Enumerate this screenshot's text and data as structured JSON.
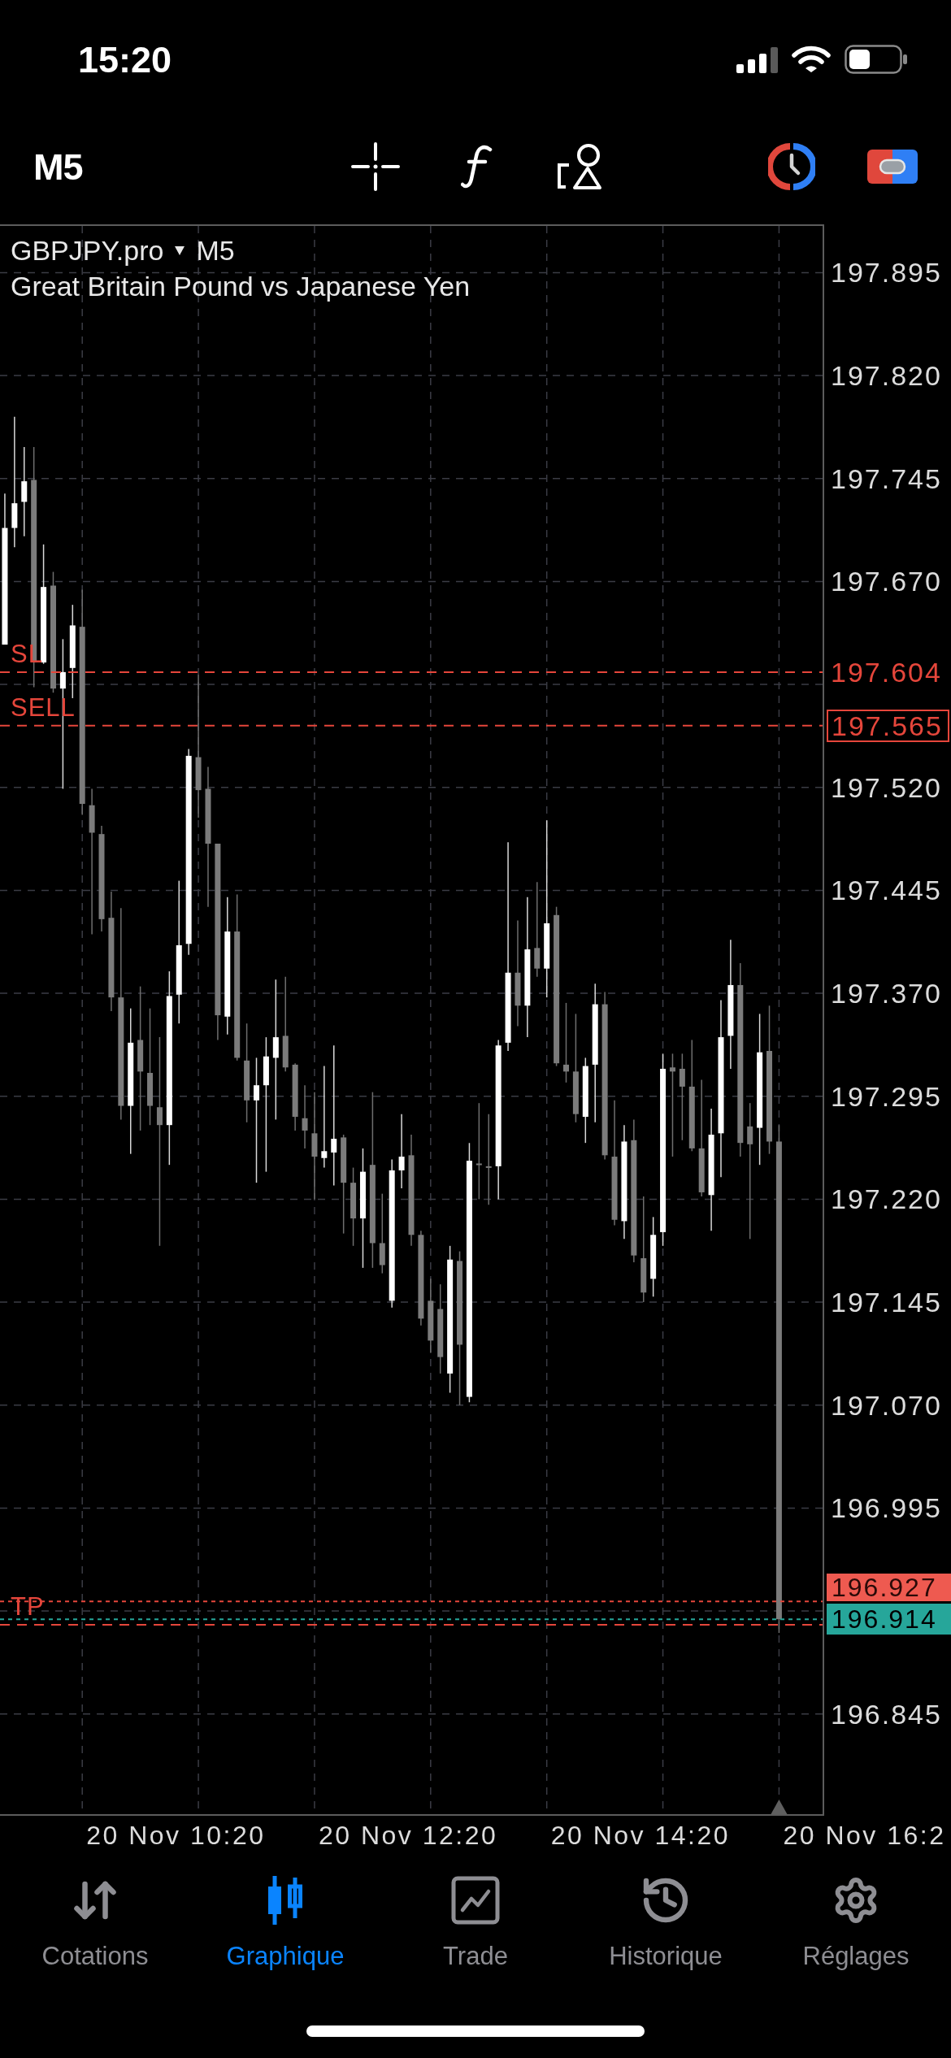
{
  "status_bar": {
    "time": "15:20"
  },
  "toolbar": {
    "timeframe": "M5"
  },
  "chart": {
    "symbol": "GBPJPY.pro",
    "timeframe": "M5",
    "description": "Great Britain Pound vs Japanese Yen",
    "chart_data": {
      "type": "candlestick",
      "grid": true,
      "categories": [
        null,
        null,
        null,
        null,
        null,
        null,
        null,
        null,
        null,
        null,
        null,
        null,
        null,
        null,
        null,
        null,
        null,
        null,
        null,
        null,
        null,
        null,
        null,
        null,
        null,
        null,
        null,
        null,
        null,
        null,
        null,
        null,
        null,
        null,
        null,
        null,
        null,
        null,
        null,
        null,
        null,
        null,
        null,
        null,
        null,
        null,
        null,
        null,
        null,
        null,
        null,
        null,
        null,
        null,
        null,
        null,
        null,
        null,
        null,
        null,
        null,
        null,
        null,
        null,
        null,
        null,
        null,
        null,
        null,
        null,
        null,
        null,
        null,
        null,
        null,
        null,
        null,
        null,
        null,
        null,
        null,
        null,
        null,
        null,
        null
      ],
      "ohlc": [
        [
          197.624,
          197.734,
          197.624,
          197.709
        ],
        [
          197.709,
          197.79,
          197.695,
          197.727
        ],
        [
          197.728,
          197.768,
          197.703,
          197.743
        ],
        [
          197.744,
          197.768,
          197.593,
          197.611
        ],
        [
          197.611,
          197.697,
          197.61,
          197.666
        ],
        [
          197.667,
          197.677,
          197.589,
          197.592
        ],
        [
          197.592,
          197.628,
          197.519,
          197.604
        ],
        [
          197.607,
          197.653,
          197.585,
          197.638
        ],
        [
          197.637,
          197.664,
          197.5,
          197.508
        ],
        [
          197.507,
          197.519,
          197.413,
          197.487
        ],
        [
          197.486,
          197.492,
          197.415,
          197.424
        ],
        [
          197.425,
          197.444,
          197.357,
          197.367
        ],
        [
          197.367,
          197.432,
          197.278,
          197.288
        ],
        [
          197.288,
          197.359,
          197.253,
          197.334
        ],
        [
          197.336,
          197.375,
          197.27,
          197.313
        ],
        [
          197.312,
          197.359,
          197.274,
          197.288
        ],
        [
          197.287,
          197.338,
          197.186,
          197.274
        ],
        [
          197.274,
          197.386,
          197.245,
          197.368
        ],
        [
          197.369,
          197.452,
          197.348,
          197.405
        ],
        [
          197.406,
          197.548,
          197.398,
          197.543
        ],
        [
          197.542,
          197.602,
          197.498,
          197.518
        ],
        [
          197.519,
          197.535,
          197.433,
          197.479
        ],
        [
          197.479,
          197.479,
          197.336,
          197.354
        ],
        [
          197.353,
          197.44,
          197.34,
          197.415
        ],
        [
          197.415,
          197.442,
          197.321,
          197.323
        ],
        [
          197.321,
          197.348,
          197.276,
          197.292
        ],
        [
          197.292,
          197.323,
          197.232,
          197.303
        ],
        [
          197.303,
          197.338,
          197.24,
          197.324
        ],
        [
          197.323,
          197.38,
          197.278,
          197.338
        ],
        [
          197.339,
          197.382,
          197.313,
          197.316
        ],
        [
          197.318,
          197.319,
          197.27,
          197.28
        ],
        [
          197.279,
          197.303,
          197.257,
          197.27
        ],
        [
          197.268,
          197.298,
          197.22,
          197.251
        ],
        [
          197.25,
          197.317,
          197.243,
          197.255
        ],
        [
          197.254,
          197.332,
          197.23,
          197.264
        ],
        [
          197.265,
          197.267,
          197.195,
          197.232
        ],
        [
          197.232,
          197.243,
          197.186,
          197.206
        ],
        [
          197.206,
          197.257,
          197.17,
          197.24
        ],
        [
          197.245,
          197.298,
          197.17,
          197.188
        ],
        [
          197.188,
          197.224,
          197.166,
          197.172
        ],
        [
          197.146,
          197.249,
          197.141,
          197.241
        ],
        [
          197.241,
          197.282,
          197.228,
          197.251
        ],
        [
          197.252,
          197.267,
          197.186,
          197.194
        ],
        [
          197.194,
          197.197,
          197.128,
          197.133
        ],
        [
          197.146,
          197.162,
          197.108,
          197.117
        ],
        [
          197.14,
          197.158,
          197.093,
          197.105
        ],
        [
          197.093,
          197.186,
          197.079,
          197.176
        ],
        [
          197.175,
          197.182,
          197.07,
          197.114
        ],
        [
          197.076,
          197.261,
          197.072,
          197.248
        ],
        [
          197.246,
          197.29,
          197.22,
          197.245
        ],
        [
          197.244,
          197.282,
          197.216,
          197.243
        ],
        [
          197.244,
          197.336,
          197.22,
          197.332
        ],
        [
          197.334,
          197.48,
          197.328,
          197.385
        ],
        [
          197.385,
          197.423,
          197.346,
          197.361
        ],
        [
          197.361,
          197.44,
          197.338,
          197.402
        ],
        [
          197.403,
          197.451,
          197.382,
          197.388
        ],
        [
          197.388,
          197.496,
          197.367,
          197.421
        ],
        [
          197.427,
          197.433,
          197.317,
          197.319
        ],
        [
          197.318,
          197.363,
          197.305,
          197.313
        ],
        [
          197.313,
          197.355,
          197.276,
          197.282
        ],
        [
          197.28,
          197.323,
          197.261,
          197.317
        ],
        [
          197.318,
          197.377,
          197.276,
          197.362
        ],
        [
          197.362,
          197.371,
          197.249,
          197.252
        ],
        [
          197.251,
          197.292,
          197.201,
          197.205
        ],
        [
          197.204,
          197.274,
          197.191,
          197.262
        ],
        [
          197.263,
          197.278,
          197.174,
          197.179
        ],
        [
          197.177,
          197.222,
          197.145,
          197.152
        ],
        [
          197.162,
          197.207,
          197.149,
          197.194
        ],
        [
          197.196,
          197.326,
          197.186,
          197.315
        ],
        [
          197.316,
          197.326,
          197.251,
          197.313
        ],
        [
          197.315,
          197.326,
          197.263,
          197.302
        ],
        [
          197.302,
          197.336,
          197.255,
          197.257
        ],
        [
          197.257,
          197.307,
          197.222,
          197.225
        ],
        [
          197.223,
          197.286,
          197.197,
          197.267
        ],
        [
          197.268,
          197.365,
          197.236,
          197.338
        ],
        [
          197.339,
          197.409,
          197.315,
          197.376
        ],
        [
          197.376,
          197.392,
          197.251,
          197.261
        ],
        [
          197.273,
          197.29,
          197.191,
          197.26
        ],
        [
          197.272,
          197.355,
          197.245,
          197.327
        ],
        [
          197.328,
          197.361,
          197.253,
          197.262
        ],
        [
          197.262,
          197.274,
          196.904,
          196.914
        ],
        null,
        null,
        null,
        null
      ],
      "ylim": [
        196.772,
        197.929
      ],
      "yticks": [
        {
          "value": 197.895,
          "label": "197.895"
        },
        {
          "value": 197.82,
          "label": "197.820"
        },
        {
          "value": 197.745,
          "label": "197.745"
        },
        {
          "value": 197.67,
          "label": "197.670"
        },
        {
          "value": 197.52,
          "label": "197.520"
        },
        {
          "value": 197.445,
          "label": "197.445"
        },
        {
          "value": 197.37,
          "label": "197.370"
        },
        {
          "value": 197.295,
          "label": "197.295"
        },
        {
          "value": 197.22,
          "label": "197.220"
        },
        {
          "value": 197.145,
          "label": "197.145"
        },
        {
          "value": 197.07,
          "label": "197.070"
        },
        {
          "value": 196.995,
          "label": "196.995"
        },
        {
          "value": 196.845,
          "label": "196.845"
        }
      ],
      "ref_lines": [
        {
          "axis": "y",
          "value": 197.604,
          "label": "197.604"
        },
        {
          "axis": "y",
          "value": 197.565,
          "label": "197.565"
        },
        {
          "axis": "y",
          "value": 196.91
        },
        {
          "axis": "y",
          "value": 196.927,
          "label": "196.927"
        },
        {
          "axis": "y",
          "value": 196.914,
          "label": "196.914"
        }
      ]
    },
    "levels": [
      {
        "kind": "stop_loss",
        "tag": "SL"
      },
      {
        "kind": "sell_order",
        "tag": "SELL"
      },
      {
        "kind": "take_profit",
        "tag": "TP"
      },
      {
        "kind": "ask"
      },
      {
        "kind": "bid"
      }
    ],
    "time_labels": [
      "20 Nov 10:20",
      "20 Nov 12:20",
      "20 Nov 14:20",
      "20 Nov 16:2"
    ]
  },
  "tabs": [
    {
      "kind": "quotes",
      "label": "Cotations",
      "selected": false
    },
    {
      "kind": "chart",
      "label": "Graphique",
      "selected": true
    },
    {
      "kind": "trade",
      "label": "Trade",
      "selected": false
    },
    {
      "kind": "history",
      "label": "Historique",
      "selected": false
    },
    {
      "kind": "settings",
      "label": "Réglages",
      "selected": false
    }
  ]
}
